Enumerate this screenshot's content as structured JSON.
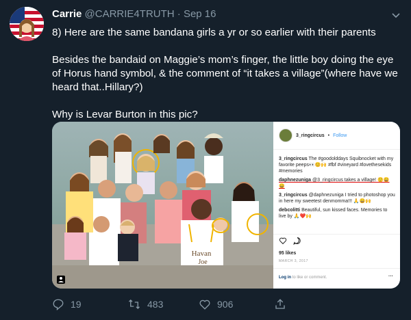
{
  "tweet": {
    "author_name": "Carrie",
    "handle": "@CARRIE4TRUTH",
    "separator": "·",
    "date": "Sep 16",
    "paragraphs": [
      "8) Here are the same bandana girls a yr or so earlier with their parents",
      "Besides the bandaid on Maggie’s mom’s finger, the little boy doing the eye of Horus hand symbol, & the comment of “it takes a village”(where have we heard that..Hillary?)",
      "Why is Levar Burton in this pic?"
    ]
  },
  "instagram": {
    "username": "3_ringcircus",
    "follow_sep": "•",
    "follow": "Follow",
    "comments": [
      {
        "user": "3_ringcircus",
        "text": "The #goodolddays Squibnocket with my favorite peeps👀😊🙌 #fbf #vineyard #lovethesekids #memories"
      },
      {
        "user": "daphnezuniga",
        "text": "@3_ringcircus takes a village! 🙂😄😄"
      },
      {
        "user": "3_ringcircus",
        "text": "@daphnezuniga I tried to photoshop you in here my sweetest denmomma!!! 🙏😄🙌"
      },
      {
        "user": "debcolitti",
        "text": "Beautiful, sun kissed faces. Memories to live by 🙏❤️🙌"
      }
    ],
    "likes": "95 likes",
    "date": "MARCH 3, 2017",
    "login_link": "Log in",
    "login_rest": " to like or comment.",
    "more": "···"
  },
  "photo": {
    "shirt_text_line1": "Havan",
    "shirt_text_line2": "Joe"
  },
  "actions": {
    "reply_count": "19",
    "retweet_count": "483",
    "like_count": "906"
  },
  "colors": {
    "background": "#15202b",
    "muted": "#8899a6",
    "text": "#ffffff"
  },
  "icons": [
    "flag-avatar-icon",
    "chevron-down-icon",
    "reply-icon",
    "retweet-icon",
    "heart-icon",
    "share-icon"
  ]
}
